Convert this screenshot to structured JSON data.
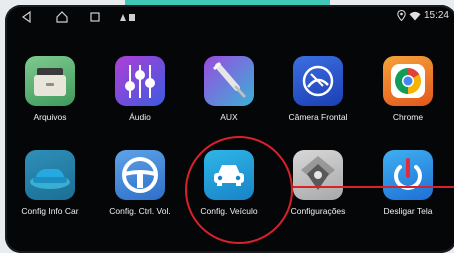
{
  "statusbar": {
    "time": "15:24",
    "icons": [
      "back-icon",
      "home-icon",
      "recents-icon",
      "notification-icons",
      "location-icon",
      "wifi-icon"
    ]
  },
  "apps": [
    {
      "label": "Arquivos",
      "icon": "folder-icon"
    },
    {
      "label": "Áudio",
      "icon": "equalizer-icon"
    },
    {
      "label": "AUX",
      "icon": "aux-cable-icon"
    },
    {
      "label": "Câmera Frontal",
      "icon": "camera-icon"
    },
    {
      "label": "Chrome",
      "icon": "chrome-icon"
    },
    {
      "label": "Config Info Car",
      "icon": "car-info-icon"
    },
    {
      "label": "Config. Ctrl. Vol.",
      "icon": "steering-wheel-icon"
    },
    {
      "label": "Config. Veículo",
      "icon": "car-settings-icon"
    },
    {
      "label": "Configurações",
      "icon": "settings-icon"
    },
    {
      "label": "Desligar Tela",
      "icon": "power-icon"
    }
  ],
  "highlight": {
    "target": "Config. Veículo",
    "color": "#d8212b"
  }
}
